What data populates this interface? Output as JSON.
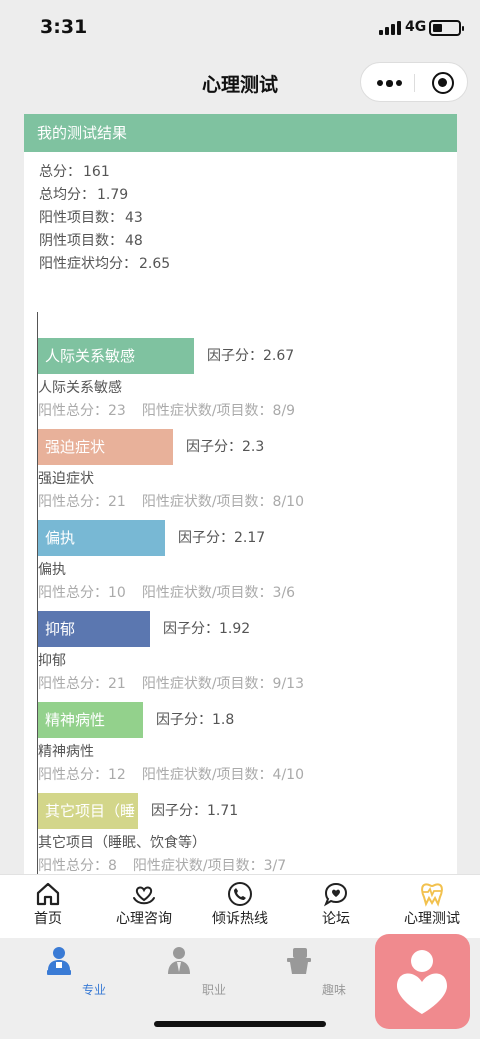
{
  "status": {
    "time": "3:31",
    "network": "4G"
  },
  "nav": {
    "title": "心理测试"
  },
  "result": {
    "header": "我的测试结果",
    "summary": [
      {
        "label": "总分：",
        "value": "161"
      },
      {
        "label": "总均分：",
        "value": "1.79"
      },
      {
        "label": "阳性项目数：",
        "value": "43"
      },
      {
        "label": "阴性项目数：",
        "value": "48"
      },
      {
        "label": "阳性症状均分：",
        "value": "2.65"
      }
    ]
  },
  "chart_data": {
    "type": "bar",
    "orientation": "horizontal",
    "score_prefix": "因子分：",
    "total_label": "阳性总分：",
    "ratio_label": "阳性症状数/项目数：",
    "factors": [
      {
        "bar_label": "人际关系敏感",
        "name": "人际关系敏感",
        "score": "2.67",
        "positive_total": "23",
        "ratio": "8/9",
        "color": "#7fc2a0"
      },
      {
        "bar_label": "强迫症状",
        "name": "强迫症状",
        "score": "2.3",
        "positive_total": "21",
        "ratio": "8/10",
        "color": "#e8b19a"
      },
      {
        "bar_label": "偏执",
        "name": "偏执",
        "score": "2.17",
        "positive_total": "10",
        "ratio": "3/6",
        "color": "#78b8d4"
      },
      {
        "bar_label": "抑郁",
        "name": "抑郁",
        "score": "1.92",
        "positive_total": "21",
        "ratio": "9/13",
        "color": "#5b77b0"
      },
      {
        "bar_label": "精神病性",
        "name": "精神病性",
        "score": "1.8",
        "positive_total": "12",
        "ratio": "4/10",
        "color": "#93d18c"
      },
      {
        "bar_label": "其它项目（睡",
        "name": "其它项目（睡眠、饮食等）",
        "score": "1.71",
        "positive_total": "8",
        "ratio": "3/7",
        "color": "#d3d68a"
      }
    ]
  },
  "tabbar": [
    {
      "label": "首页",
      "icon": "home-icon"
    },
    {
      "label": "心理咨询",
      "icon": "heart-hand-icon"
    },
    {
      "label": "倾诉热线",
      "icon": "phone-icon"
    },
    {
      "label": "论坛",
      "icon": "chat-heart-icon"
    },
    {
      "label": "心理测试",
      "icon": "heartbeat-tooth-icon",
      "active": true
    }
  ],
  "systabs": [
    {
      "label": "专业",
      "icon": "doctor-icon",
      "active": true
    },
    {
      "label": "职业",
      "icon": "worker-icon"
    },
    {
      "label": "趣味",
      "icon": "game-icon"
    }
  ],
  "colors": {
    "accent": "#7fc2a0",
    "active_tab": "#3a7bd5",
    "fab": "#f08a8e",
    "tab_active_icon": "#f2c14e"
  }
}
